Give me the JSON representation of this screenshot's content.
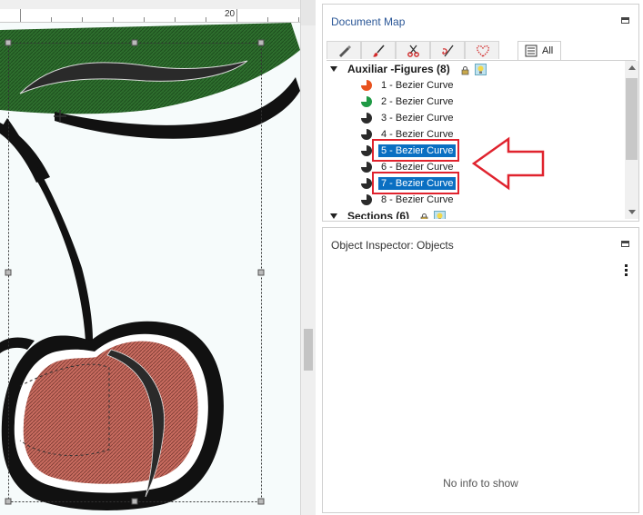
{
  "ruler": {
    "label": "20"
  },
  "document_map": {
    "title": "Document Map",
    "tabs": [
      {
        "name": "pencil-icon"
      },
      {
        "name": "brush-icon"
      },
      {
        "name": "scissors-icon"
      },
      {
        "name": "needle-icon"
      },
      {
        "name": "heart-stitch-icon"
      },
      {
        "name": "list-icon",
        "label": "All",
        "active": true
      }
    ],
    "groups": [
      {
        "label": "Auxiliar -Figures (8)",
        "items": [
          {
            "label": "1 - Bezier Curve",
            "color": "#e8521e",
            "selected": false
          },
          {
            "label": "2 - Bezier Curve",
            "color": "#1f9a45",
            "selected": false
          },
          {
            "label": "3 - Bezier Curve",
            "color": "#2b2b2b",
            "selected": false
          },
          {
            "label": "4 - Bezier Curve",
            "color": "#2b2b2b",
            "selected": false
          },
          {
            "label": "5 - Bezier Curve",
            "color": "#2b2b2b",
            "selected": true
          },
          {
            "label": "6 - Bezier Curve",
            "color": "#2b2b2b",
            "selected": false
          },
          {
            "label": "7 - Bezier Curve",
            "color": "#2b2b2b",
            "selected": true
          },
          {
            "label": "8 - Bezier Curve",
            "color": "#2b2b2b",
            "selected": false
          }
        ]
      },
      {
        "label": "Sections (6)"
      }
    ]
  },
  "object_inspector": {
    "title": "Object Inspector: Objects",
    "empty_text": "No info to show"
  },
  "colors": {
    "selection": "#0a6fc2",
    "annotation_red": "#e0232e",
    "leaf_green": "#2f7a2f",
    "cherry_red": "#c86a5e"
  }
}
